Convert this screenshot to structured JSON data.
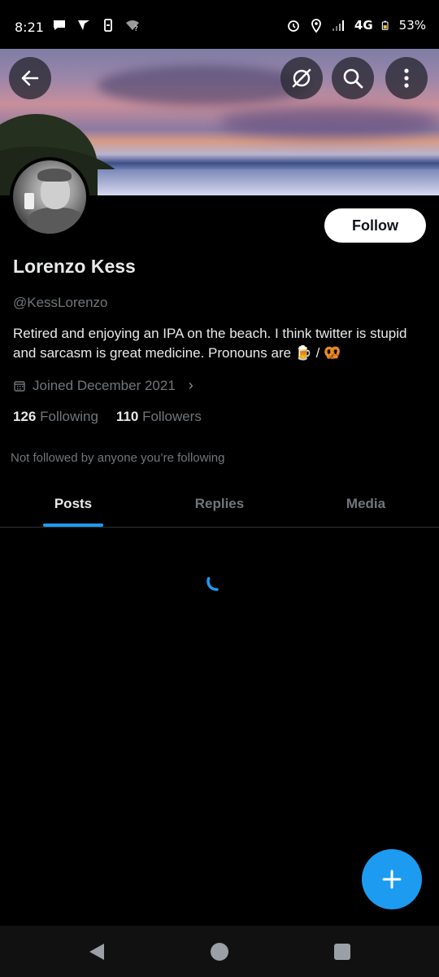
{
  "status_bar": {
    "time": "8:21",
    "network": "4G",
    "battery": "53%",
    "left_icons": [
      "chat-bubble-icon",
      "vpn-icon",
      "phone-icon",
      "wifi-question-icon"
    ],
    "right_icons": [
      "alarm-icon",
      "location-icon",
      "signal-icon",
      "battery-icon"
    ]
  },
  "header": {
    "icons": [
      "back-arrow-icon",
      "grok-icon",
      "search-icon",
      "more-vertical-icon"
    ]
  },
  "profile": {
    "display_name": "Lorenzo Kess",
    "handle": "@KessLorenzo",
    "bio": "Retired and enjoying an IPA on the beach. I think twitter is stupid and sarcasm is great medicine. Pronouns are 🍺 / 🥨",
    "joined": "Joined December 2021",
    "following_count": "126",
    "following_label": "Following",
    "followers_count": "110",
    "followers_label": "Followers",
    "not_followed_note": "Not followed by anyone you’re following",
    "follow_button": "Follow"
  },
  "tabs": [
    {
      "label": "Posts",
      "active": true
    },
    {
      "label": "Replies",
      "active": false
    },
    {
      "label": "Media",
      "active": false
    }
  ],
  "colors": {
    "accent": "#1d9bf0",
    "background": "#000000",
    "secondary_text": "#71767b",
    "primary_text": "#e7e9ea"
  },
  "fab": {
    "icon": "plus-icon"
  },
  "nav_bar": {
    "icons": [
      "nav-back-icon",
      "nav-home-icon",
      "nav-recents-icon"
    ]
  }
}
